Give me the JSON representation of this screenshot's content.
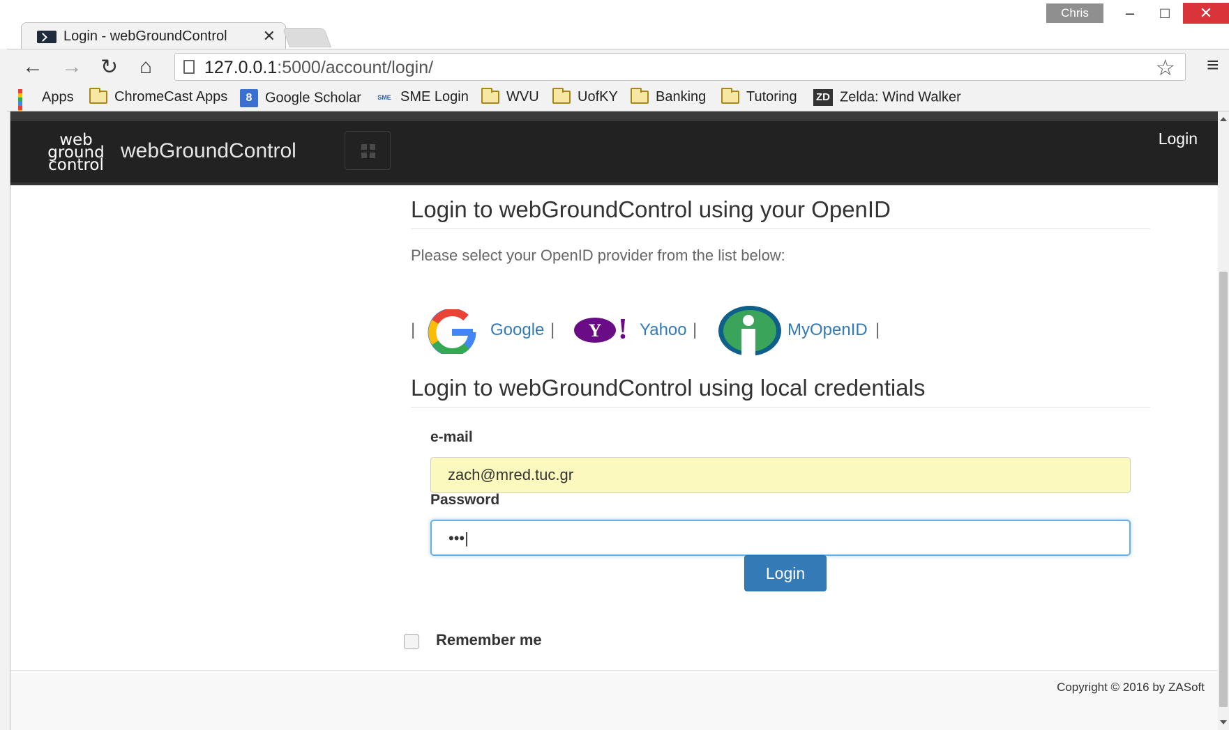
{
  "window": {
    "user_label": "Chris",
    "minimize_glyph": "–",
    "maximize_glyph": "□",
    "close_glyph": "✕"
  },
  "tab": {
    "title": "Login - webGroundControl",
    "close_glyph": "✕"
  },
  "toolbar": {
    "back_glyph": "←",
    "forward_glyph": "→",
    "reload_glyph": "↻",
    "home_glyph": "⌂",
    "url_host": "127.0.0.1",
    "url_path": ":5000/account/login/",
    "star_glyph": "☆",
    "menu_glyph": "≡"
  },
  "bookmarks": {
    "items": [
      {
        "label": "Apps",
        "icon": "apps-grid-icon"
      },
      {
        "label": "ChromeCast Apps",
        "icon": "folder-icon"
      },
      {
        "label": "Google Scholar",
        "icon": "google-scholar-icon",
        "icon_text": "8"
      },
      {
        "label": "SME Login",
        "icon": "sme-icon",
        "icon_text": "SME"
      },
      {
        "label": "WVU",
        "icon": "folder-icon"
      },
      {
        "label": "UofKY",
        "icon": "folder-icon"
      },
      {
        "label": "Banking",
        "icon": "folder-icon"
      },
      {
        "label": "Tutoring",
        "icon": "folder-icon"
      },
      {
        "label": "Zelda: Wind Walker",
        "icon": "zd-icon",
        "icon_text": "ZD"
      }
    ]
  },
  "navbar": {
    "logo_lines": [
      "web",
      "ground",
      "control"
    ],
    "brand": "webGroundControl",
    "login_link": "Login",
    "bg_color": "#222222"
  },
  "openid": {
    "heading": "Login to webGroundControl using your OpenID",
    "subtitle": "Please select your OpenID provider from the list below:",
    "separator": "|",
    "providers": [
      {
        "name": "Google",
        "icon": "google-logo-icon"
      },
      {
        "name": "Yahoo",
        "icon": "yahoo-logo-icon",
        "icon_text": "Y!"
      },
      {
        "name": "MyOpenID",
        "icon": "myopenid-logo-icon"
      }
    ]
  },
  "local": {
    "heading": "Login to webGroundControl using local credentials",
    "email_label": "e-mail",
    "email_value": "zach@mred.tuc.gr",
    "password_label": "Password",
    "password_mask": "•••|",
    "login_button": "Login",
    "remember_label": "Remember me"
  },
  "footer": {
    "copyright": "Copyright © 2016 by ZASoft"
  },
  "colors": {
    "link": "#337ab7",
    "button": "#337ab7",
    "autofill": "#fbf9bd",
    "focus": "#66afe9"
  }
}
